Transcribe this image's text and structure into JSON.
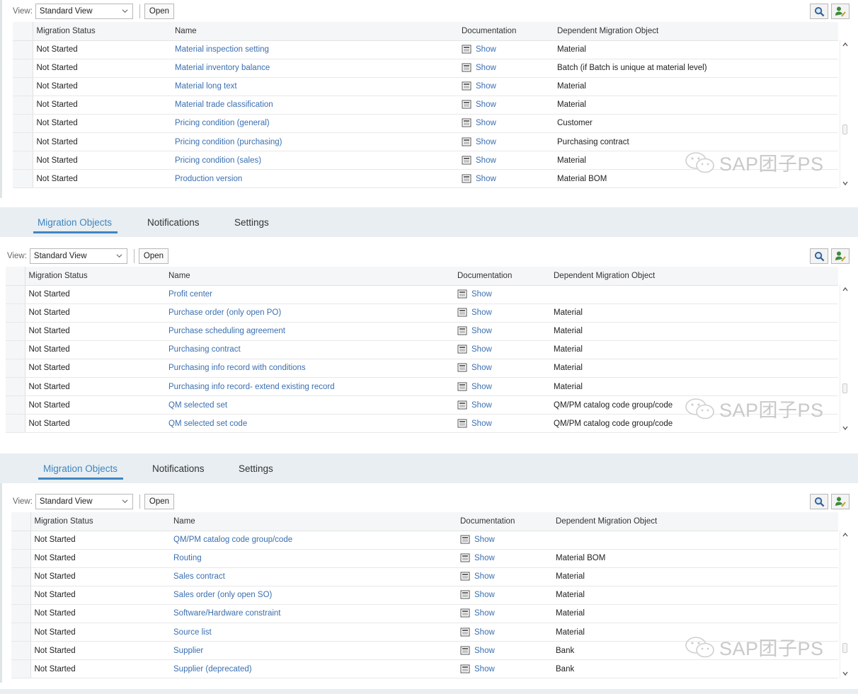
{
  "toolbar": {
    "view_label": "View:",
    "view_value": "Standard View",
    "open_label": "Open"
  },
  "tabs": [
    {
      "label": "Migration Objects",
      "active": true
    },
    {
      "label": "Notifications",
      "active": false
    },
    {
      "label": "Settings",
      "active": false
    }
  ],
  "columns": [
    "Migration Status",
    "Name",
    "Documentation",
    "Dependent Migration Object"
  ],
  "watermark": "SAP团子PS",
  "colors": {
    "link": "#3a6fb0",
    "tab_active": "#3f85c0",
    "tabbar_bg": "#e8eef1"
  },
  "panel1": {
    "rows": [
      {
        "status": "Not Started",
        "name": "Material inspection setting",
        "doc": "Show",
        "dep": "Material"
      },
      {
        "status": "Not Started",
        "name": "Material inventory balance",
        "doc": "Show",
        "dep": "Batch (if Batch is unique at material level)"
      },
      {
        "status": "Not Started",
        "name": "Material long text",
        "doc": "Show",
        "dep": "Material"
      },
      {
        "status": "Not Started",
        "name": "Material trade classification",
        "doc": "Show",
        "dep": "Material"
      },
      {
        "status": "Not Started",
        "name": "Pricing condition (general)",
        "doc": "Show",
        "dep": "Customer"
      },
      {
        "status": "Not Started",
        "name": "Pricing condition (purchasing)",
        "doc": "Show",
        "dep": "Purchasing contract"
      },
      {
        "status": "Not Started",
        "name": "Pricing condition (sales)",
        "doc": "Show",
        "dep": "Material"
      },
      {
        "status": "Not Started",
        "name": "Production version",
        "doc": "Show",
        "dep": "Material BOM"
      }
    ]
  },
  "panel2": {
    "rows": [
      {
        "status": "Not Started",
        "name": "Profit center",
        "doc": "Show",
        "dep": ""
      },
      {
        "status": "Not Started",
        "name": "Purchase order (only open PO)",
        "doc": "Show",
        "dep": "Material"
      },
      {
        "status": "Not Started",
        "name": "Purchase scheduling agreement",
        "doc": "Show",
        "dep": "Material"
      },
      {
        "status": "Not Started",
        "name": "Purchasing contract",
        "doc": "Show",
        "dep": "Material"
      },
      {
        "status": "Not Started",
        "name": "Purchasing info record with conditions",
        "doc": "Show",
        "dep": "Material"
      },
      {
        "status": "Not Started",
        "name": "Purchasing info record- extend existing record",
        "doc": "Show",
        "dep": "Material"
      },
      {
        "status": "Not Started",
        "name": "QM selected set",
        "doc": "Show",
        "dep": "QM/PM catalog code group/code"
      },
      {
        "status": "Not Started",
        "name": "QM selected set code",
        "doc": "Show",
        "dep": "QM/PM catalog code group/code"
      }
    ]
  },
  "panel3": {
    "rows": [
      {
        "status": "Not Started",
        "name": "QM/PM catalog code group/code",
        "doc": "Show",
        "dep": ""
      },
      {
        "status": "Not Started",
        "name": "Routing",
        "doc": "Show",
        "dep": "Material BOM"
      },
      {
        "status": "Not Started",
        "name": "Sales contract",
        "doc": "Show",
        "dep": "Material"
      },
      {
        "status": "Not Started",
        "name": "Sales order (only open SO)",
        "doc": "Show",
        "dep": "Material"
      },
      {
        "status": "Not Started",
        "name": "Software/Hardware constraint",
        "doc": "Show",
        "dep": "Material"
      },
      {
        "status": "Not Started",
        "name": "Source list",
        "doc": "Show",
        "dep": "Material"
      },
      {
        "status": "Not Started",
        "name": "Supplier",
        "doc": "Show",
        "dep": "Bank"
      },
      {
        "status": "Not Started",
        "name": "Supplier (deprecated)",
        "doc": "Show",
        "dep": "Bank"
      }
    ]
  }
}
